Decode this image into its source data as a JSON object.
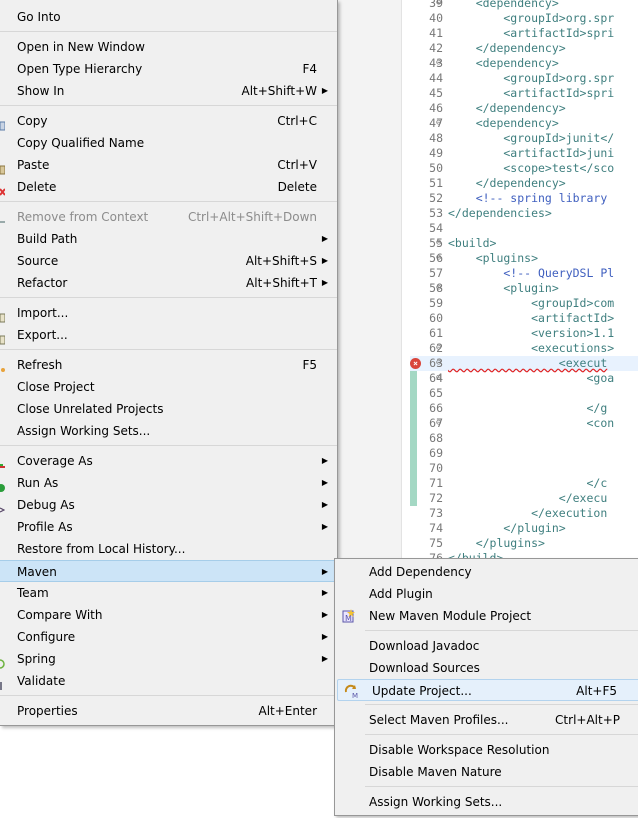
{
  "editor": {
    "lines": [
      {
        "n": "39",
        "fold": "⊖",
        "code": "    <dependency>"
      },
      {
        "n": "40",
        "code": "        <groupId>org.spr"
      },
      {
        "n": "41",
        "code": "        <artifactId>spri"
      },
      {
        "n": "42",
        "code": "    </dependency>"
      },
      {
        "n": "43",
        "fold": "⊖",
        "code": "    <dependency>"
      },
      {
        "n": "44",
        "code": "        <groupId>org.spr"
      },
      {
        "n": "45",
        "code": "        <artifactId>spri"
      },
      {
        "n": "46",
        "code": "    </dependency>"
      },
      {
        "n": "47",
        "fold": "⊖",
        "code": "    <dependency>"
      },
      {
        "n": "48",
        "code": "        <groupId>junit</"
      },
      {
        "n": "49",
        "code": "        <artifactId>juni"
      },
      {
        "n": "50",
        "code": "        <scope>test</sco"
      },
      {
        "n": "51",
        "code": "    </dependency>"
      },
      {
        "n": "52",
        "code": "    <!-- spring library",
        "comment": true
      },
      {
        "n": "53",
        "code": "</dependencies>"
      },
      {
        "n": "54",
        "code": ""
      },
      {
        "n": "55",
        "fold": "⊖",
        "code": "<build>"
      },
      {
        "n": "56",
        "fold": "⊖",
        "code": "    <plugins>"
      },
      {
        "n": "57",
        "code": "        <!-- QueryDSL Pl",
        "comment": true
      },
      {
        "n": "58",
        "fold": "⊖",
        "code": "        <plugin>"
      },
      {
        "n": "59",
        "code": "            <groupId>com"
      },
      {
        "n": "60",
        "code": "            <artifactId>"
      },
      {
        "n": "61",
        "code": "            <version>1.1"
      },
      {
        "n": "62",
        "fold": "⊖",
        "code": "            <executions>"
      },
      {
        "n": "63",
        "fold": "⊖",
        "code": "                <execut",
        "error": true,
        "highlight": true
      },
      {
        "n": "64",
        "fold": "⊖",
        "code": "                    <goa"
      },
      {
        "n": "65",
        "code": ""
      },
      {
        "n": "66",
        "code": "                    </g"
      },
      {
        "n": "67",
        "fold": "⊖",
        "code": "                    <con"
      },
      {
        "n": "68",
        "code": ""
      },
      {
        "n": "69",
        "code": ""
      },
      {
        "n": "70",
        "code": ""
      },
      {
        "n": "71",
        "code": "                    </c"
      },
      {
        "n": "72",
        "code": "                </execu"
      },
      {
        "n": "73",
        "code": "            </execution"
      },
      {
        "n": "74",
        "code": "        </plugin>"
      },
      {
        "n": "75",
        "code": "    </plugins>"
      },
      {
        "n": "76",
        "code": "</build>"
      }
    ]
  },
  "context_menu": {
    "items": [
      {
        "label": "Go Into"
      },
      {
        "sep": true
      },
      {
        "label": "Open in New Window"
      },
      {
        "label": "Open Type Hierarchy",
        "shortcut": "F4"
      },
      {
        "label": "Show In",
        "shortcut": "Alt+Shift+W",
        "submenu": true
      },
      {
        "sep": true
      },
      {
        "label": "Copy",
        "shortcut": "Ctrl+C",
        "icon": "copy-icon"
      },
      {
        "label": "Copy Qualified Name"
      },
      {
        "label": "Paste",
        "shortcut": "Ctrl+V",
        "icon": "paste-icon"
      },
      {
        "label": "Delete",
        "shortcut": "Delete",
        "icon": "delete-icon"
      },
      {
        "sep": true
      },
      {
        "label": "Remove from Context",
        "shortcut": "Ctrl+Alt+Shift+Down",
        "disabled": true,
        "icon": "remove-context-icon"
      },
      {
        "label": "Build Path",
        "submenu": true
      },
      {
        "label": "Source",
        "shortcut": "Alt+Shift+S",
        "submenu": true
      },
      {
        "label": "Refactor",
        "shortcut": "Alt+Shift+T",
        "submenu": true
      },
      {
        "sep": true
      },
      {
        "label": "Import...",
        "icon": "import-icon"
      },
      {
        "label": "Export...",
        "icon": "export-icon"
      },
      {
        "sep": true
      },
      {
        "label": "Refresh",
        "shortcut": "F5",
        "icon": "refresh-icon"
      },
      {
        "label": "Close Project"
      },
      {
        "label": "Close Unrelated Projects"
      },
      {
        "label": "Assign Working Sets..."
      },
      {
        "sep": true
      },
      {
        "label": "Coverage As",
        "submenu": true,
        "icon": "coverage-icon"
      },
      {
        "label": "Run As",
        "submenu": true,
        "icon": "run-icon"
      },
      {
        "label": "Debug As",
        "submenu": true,
        "icon": "debug-icon"
      },
      {
        "label": "Profile As",
        "submenu": true
      },
      {
        "label": "Restore from Local History..."
      },
      {
        "label": "Maven",
        "submenu": true,
        "active": true
      },
      {
        "label": "Team",
        "submenu": true
      },
      {
        "label": "Compare With",
        "submenu": true
      },
      {
        "label": "Configure",
        "submenu": true
      },
      {
        "label": "Spring",
        "submenu": true,
        "icon": "spring-icon"
      },
      {
        "label": "Validate",
        "icon": "validate-icon"
      },
      {
        "sep": true
      },
      {
        "label": "Properties",
        "shortcut": "Alt+Enter"
      }
    ]
  },
  "maven_submenu": {
    "items": [
      {
        "label": "Add Dependency"
      },
      {
        "label": "Add Plugin"
      },
      {
        "label": "New Maven Module Project",
        "icon": "maven-module-icon"
      },
      {
        "sep": true
      },
      {
        "label": "Download Javadoc"
      },
      {
        "label": "Download Sources"
      },
      {
        "label": "Update Project...",
        "shortcut": "Alt+F5",
        "hover": true,
        "icon": "update-project-icon"
      },
      {
        "sep": true
      },
      {
        "label": "Select Maven Profiles...",
        "shortcut": "Ctrl+Alt+P"
      },
      {
        "sep": true
      },
      {
        "label": "Disable Workspace Resolution"
      },
      {
        "label": "Disable Maven Nature"
      },
      {
        "sep": true
      },
      {
        "label": "Assign Working Sets..."
      }
    ]
  },
  "colors": {
    "menu_bg": "#f0f0f0",
    "active_item": "#cce4f7",
    "hover_item": "#e5f0fb",
    "xml_tag": "#3f7f7f",
    "xml_comment": "#3f5fbf",
    "error": "#d9453b"
  }
}
